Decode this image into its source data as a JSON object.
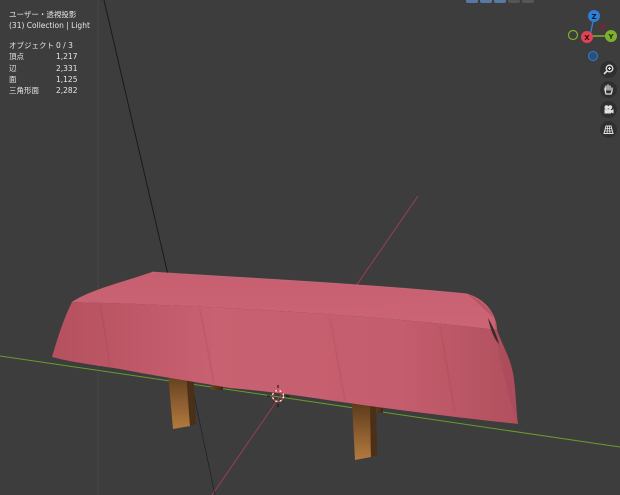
{
  "viewport": {
    "view_title": "ユーザー・透視投影",
    "collection_label": "(31) Collection | Light",
    "stats": [
      {
        "label": "オブジェクト",
        "value": "0 / 3"
      },
      {
        "label": "頂点",
        "value": "1,217"
      },
      {
        "label": "辺",
        "value": "2,331"
      },
      {
        "label": "面",
        "value": "1,125"
      },
      {
        "label": "三角形面",
        "value": "2,282"
      }
    ]
  },
  "gizmo": {
    "axes": [
      {
        "label": "Z",
        "color": "#2f7fd6"
      },
      {
        "label": "X",
        "color": "#e04454"
      },
      {
        "label": "Y",
        "color": "#7fb22c"
      }
    ]
  },
  "toolbar": {
    "icons": [
      "zoom-icon",
      "hand-pan-icon",
      "camera-icon",
      "grid-perspective-icon"
    ]
  },
  "colors": {
    "background": "#3d3d3d",
    "tablecloth": "#c45c6d",
    "table_leg": "#8a5a2e",
    "x_axis_line": "#c0405a",
    "y_axis_line": "#6a9a2a"
  }
}
